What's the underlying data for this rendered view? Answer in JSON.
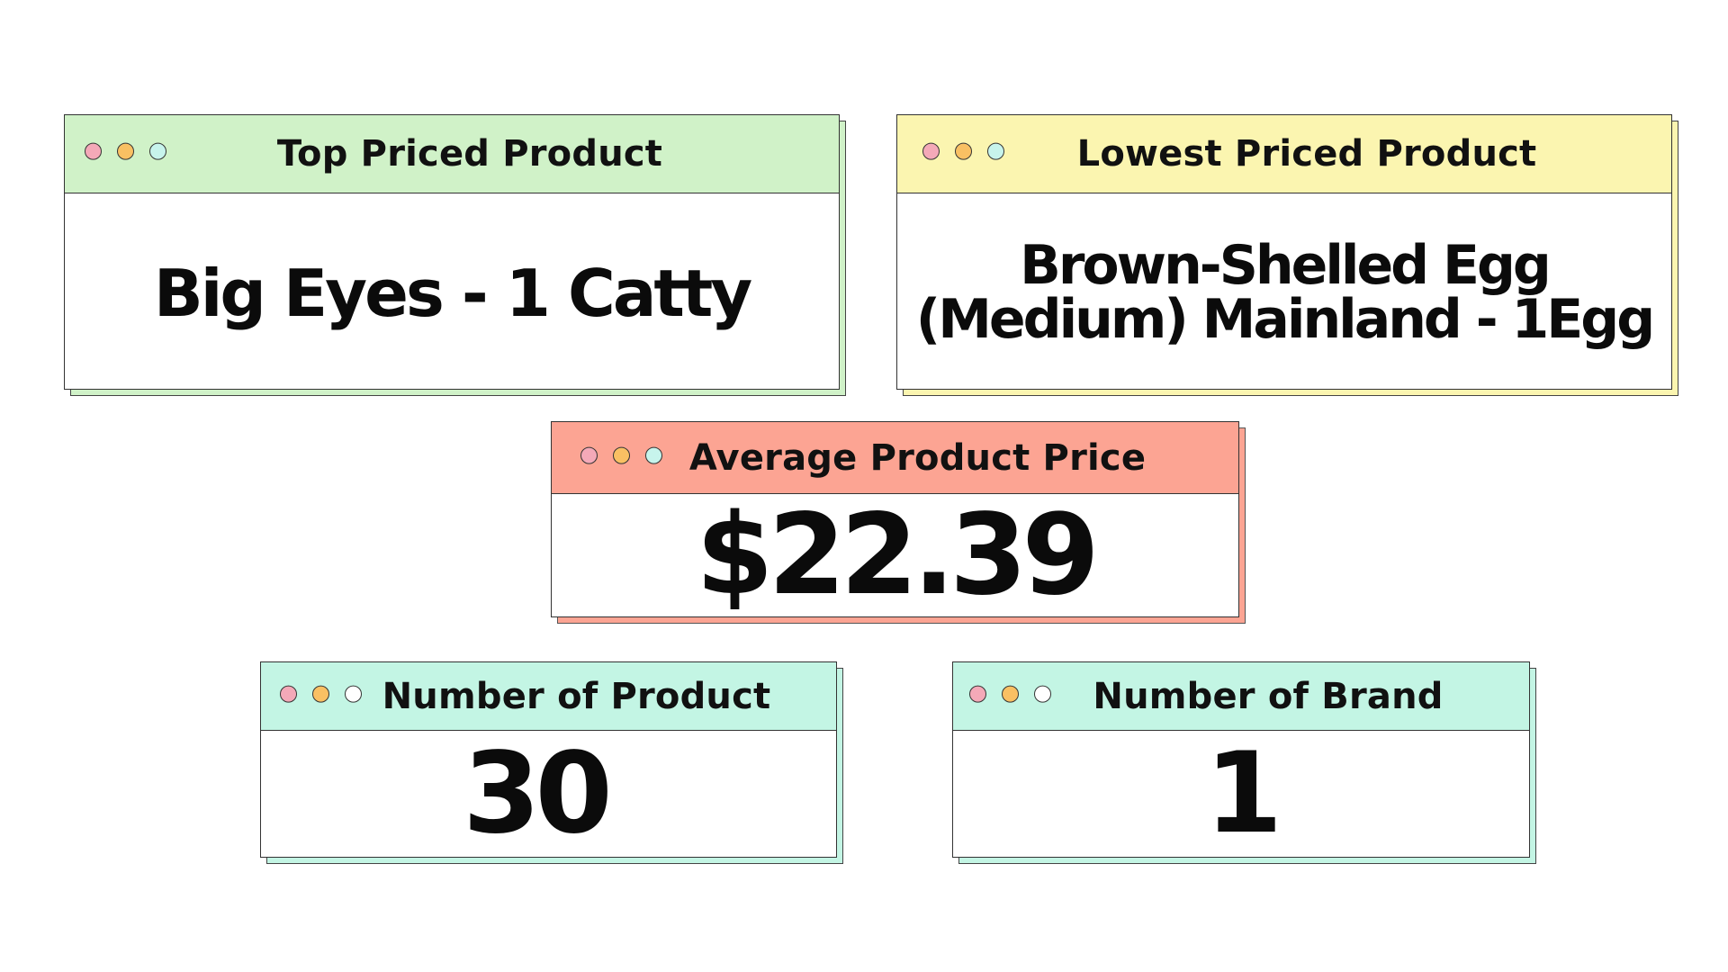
{
  "colors": {
    "green_header": "#d0f2c8",
    "yellow_header": "#fbf5b0",
    "salmon_header": "#fca493",
    "mint_header": "#c3f5e4",
    "dot_pink": "#f4a9b8",
    "dot_orange": "#f9c063",
    "dot_aqua": "#c7f4ec",
    "dot_white": "#ffffff"
  },
  "cards": {
    "top_priced": {
      "title": "Top Priced Product",
      "value": "Big Eyes - 1 Catty"
    },
    "lowest_priced": {
      "title": "Lowest Priced Product",
      "value_line1": "Brown-Shelled Egg",
      "value_line2": "(Medium) Mainland - 1Egg"
    },
    "average_price": {
      "title": "Average Product Price",
      "value": "$22.39"
    },
    "number_of_product": {
      "title": "Number of Product",
      "value": "30"
    },
    "number_of_brand": {
      "title": "Number of Brand",
      "value": "1"
    }
  }
}
